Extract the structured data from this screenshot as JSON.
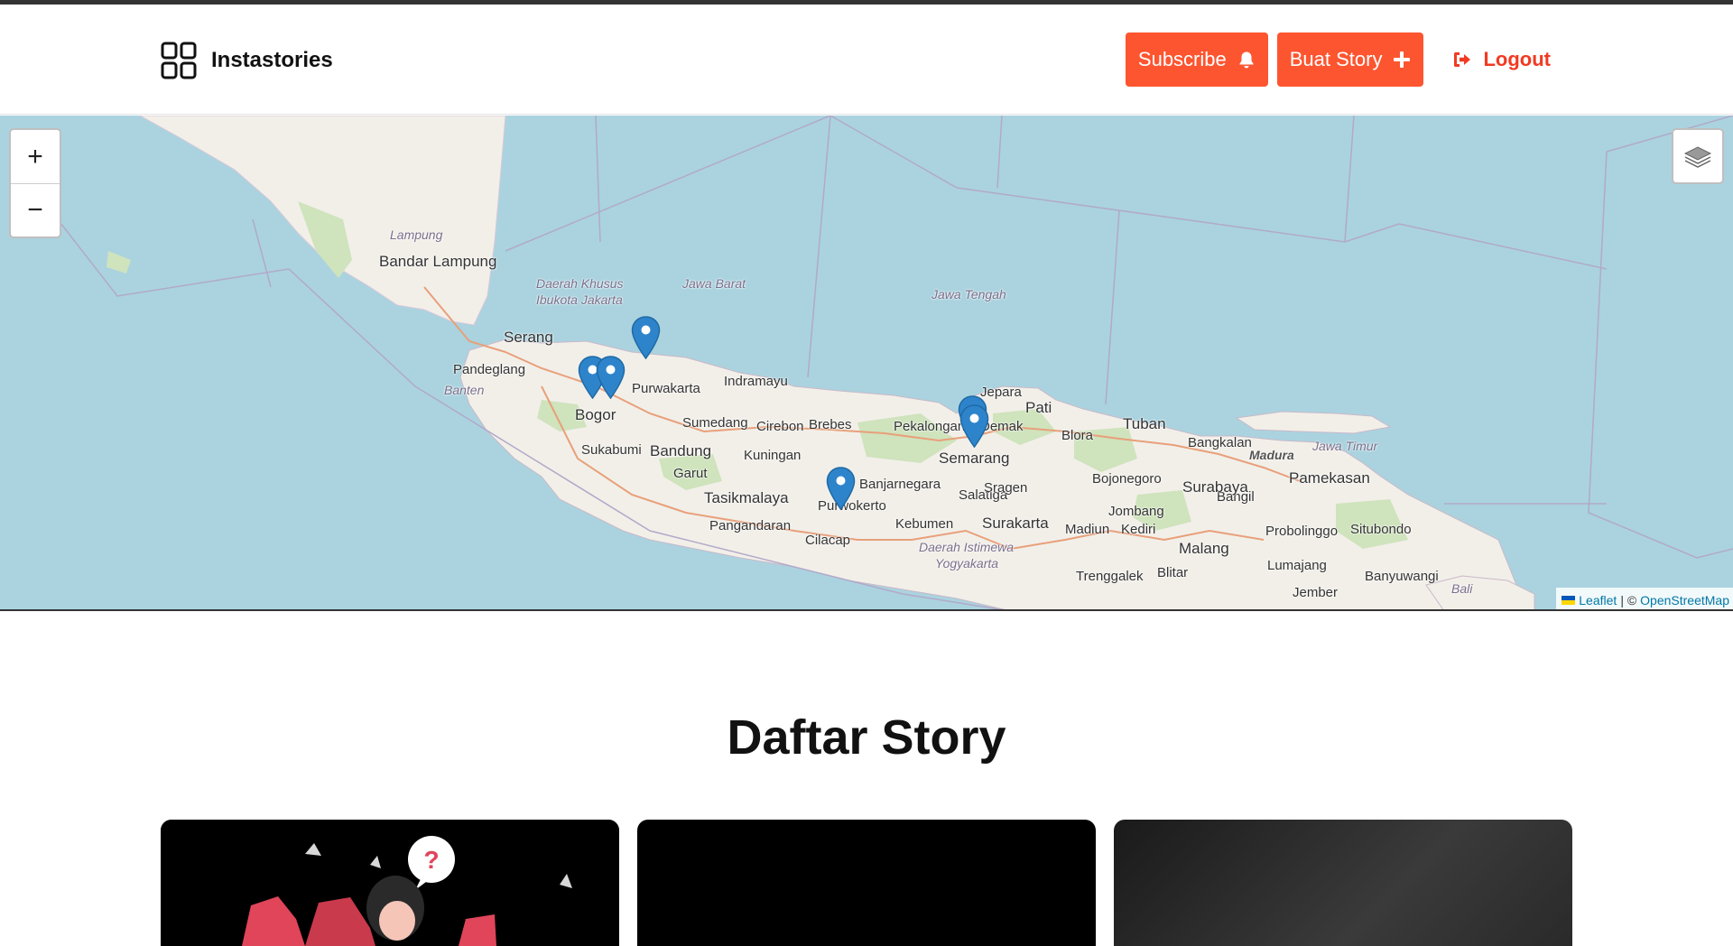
{
  "header": {
    "brand": "Instastories",
    "subscribe_label": "Subscribe",
    "create_story_label": "Buat Story",
    "logout_label": "Logout",
    "accent_color": "#fd5530",
    "logout_color": "#f23a22",
    "icons": [
      "grid-icon",
      "bell-icon",
      "plus-icon",
      "sign-out-icon"
    ]
  },
  "map": {
    "zoom_in_label": "+",
    "zoom_out_label": "−",
    "attribution": {
      "leaflet": "Leaflet",
      "separator": "| ©",
      "osm": "OpenStreetMap"
    },
    "places": {
      "lampung": "Lampung",
      "bandar_lampung": "Bandar Lampung",
      "serang": "Serang",
      "pandeglang": "Pandeglang",
      "banten": "Banten",
      "dki_1": "Daerah Khusus",
      "dki_2": "Ibukota Jakarta",
      "jawa_barat": "Jawa Barat",
      "jawa_tengah": "Jawa Tengah",
      "bogor": "Bogor",
      "purwakarta": "Purwakarta",
      "indramayu": "Indramayu",
      "sukabumi": "Sukabumi",
      "bandung": "Bandung",
      "sumedang": "Sumedang",
      "cirebon": "Cirebon",
      "brebes": "Brebes",
      "pekalongan": "Pekalongan",
      "kuningan": "Kuningan",
      "garut": "Garut",
      "tasikmalaya": "Tasikmalaya",
      "pangandaran": "Pangandaran",
      "cilacap": "Cilacap",
      "purwokerto": "Purwokerto",
      "banjarnegara": "Banjarnegara",
      "kebumen": "Kebumen",
      "diy_1": "Daerah Istimewa",
      "diy_2": "Yogyakarta",
      "semarang": "Semarang",
      "salatiga": "Salatiga",
      "surakarta": "Surakarta",
      "sragen": "Sragen",
      "jepara": "Jepara",
      "demak": "Demak",
      "pati": "Pati",
      "blora": "Blora",
      "tuban": "Tuban",
      "bojonegoro": "Bojonegoro",
      "madiun": "Madiun",
      "jombang": "Jombang",
      "kediri": "Kediri",
      "blitar": "Blitar",
      "trenggalek": "Trenggalek",
      "malang": "Malang",
      "bangil": "Bangil",
      "surabaya": "Surabaya",
      "bangkalan": "Bangkalan",
      "madura": "Madura",
      "jawa_timur": "Jawa Timur",
      "pamekasan": "Pamekasan",
      "probolinggo": "Probolinggo",
      "situbondo": "Situbondo",
      "lumajang": "Lumajang",
      "jember": "Jember",
      "banyuwangi": "Banyuwangi",
      "bali": "Bali"
    }
  },
  "main": {
    "title": "Daftar Story"
  }
}
